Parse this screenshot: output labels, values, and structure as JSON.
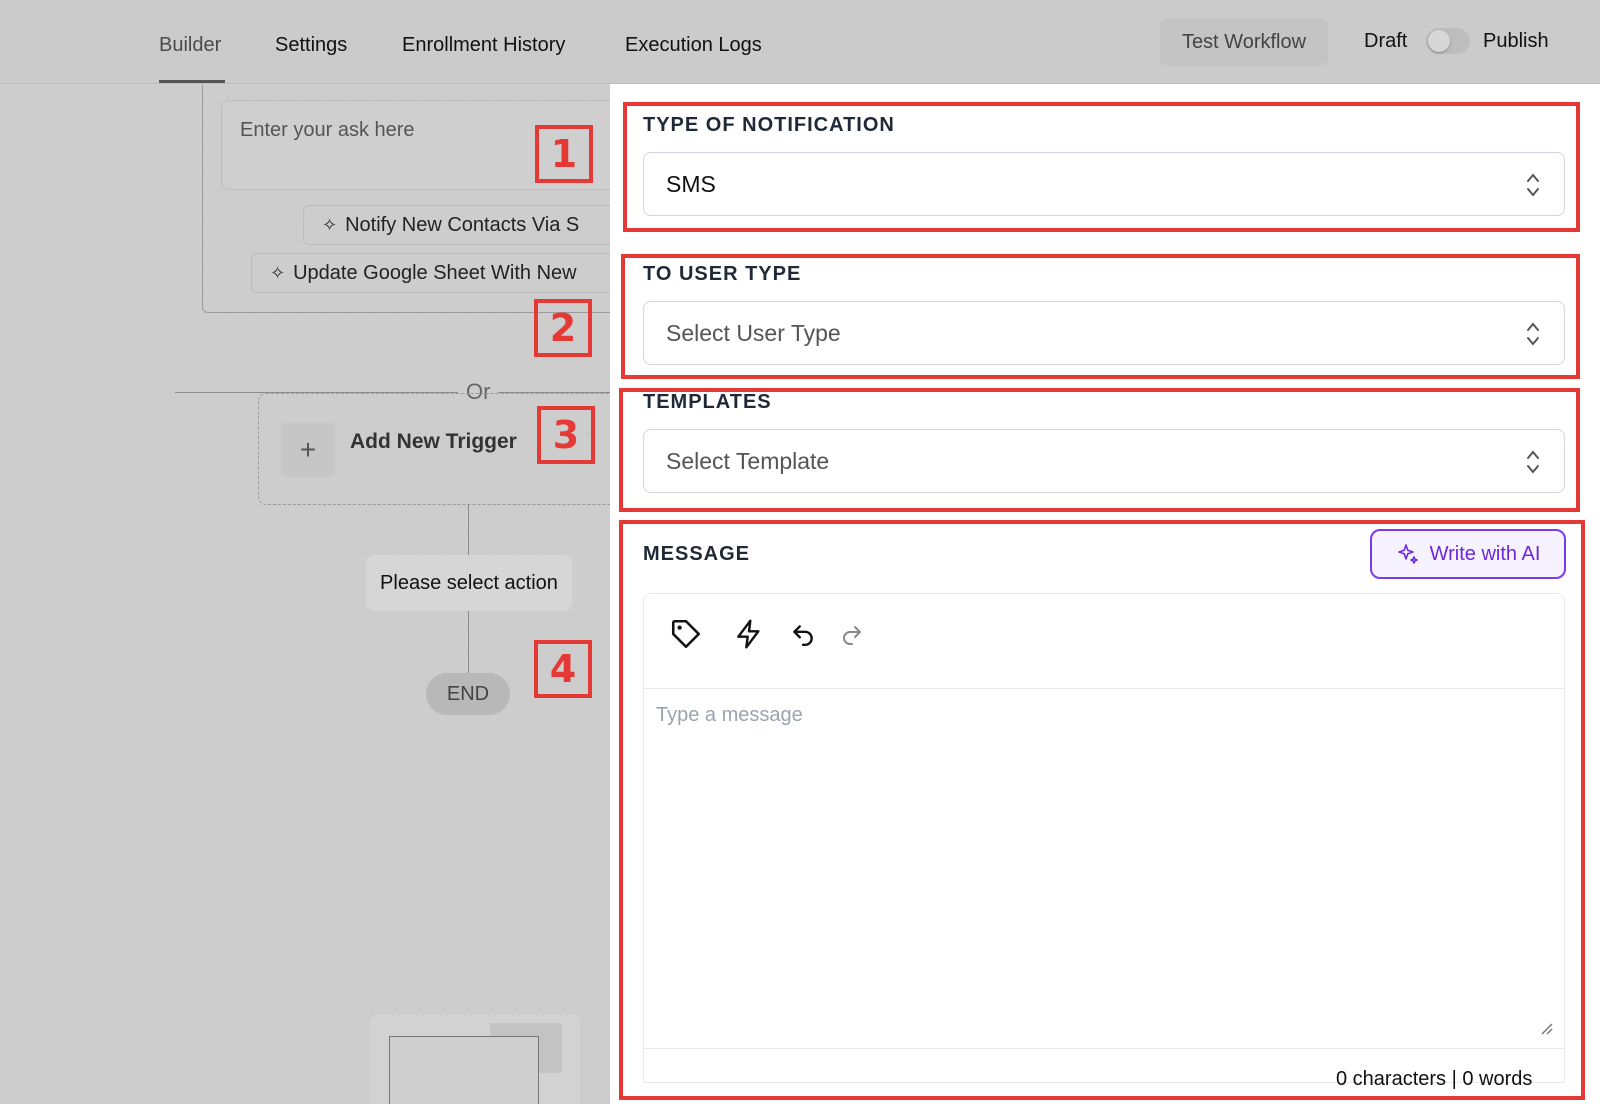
{
  "nav": {
    "tabs": [
      {
        "label": "Builder"
      },
      {
        "label": "Settings"
      },
      {
        "label": "Enrollment History"
      },
      {
        "label": "Execution Logs"
      }
    ],
    "test_workflow": "Test Workflow",
    "draft_label": "Draft",
    "publish_label": "Publish"
  },
  "canvas": {
    "ask_placeholder": "Enter your ask here",
    "suggestions": [
      {
        "label": "Notify New Contacts Via S"
      },
      {
        "label": "Update Google Sheet With New"
      }
    ],
    "or_label": "Or",
    "add_trigger": "Add New Trigger",
    "action_placeholder": "Please select action",
    "end_label": "END"
  },
  "annotations": [
    "1",
    "2",
    "3",
    "4"
  ],
  "panel": {
    "notification_type": {
      "label": "TYPE OF NOTIFICATION",
      "value": "SMS"
    },
    "user_type": {
      "label": "TO USER TYPE",
      "placeholder": "Select User Type"
    },
    "templates": {
      "label": "TEMPLATES",
      "placeholder": "Select Template"
    },
    "message": {
      "label": "MESSAGE",
      "write_ai": "Write with AI",
      "placeholder": "Type a message",
      "counter": "0 characters | 0 words"
    }
  },
  "icons": [
    "tag-icon",
    "lightning-icon",
    "undo-icon",
    "redo-icon",
    "sparkle-icon",
    "chevron-updown-icon"
  ],
  "colors": {
    "annotation_red": "#e53935",
    "ai_purple": "#7c3aed"
  }
}
